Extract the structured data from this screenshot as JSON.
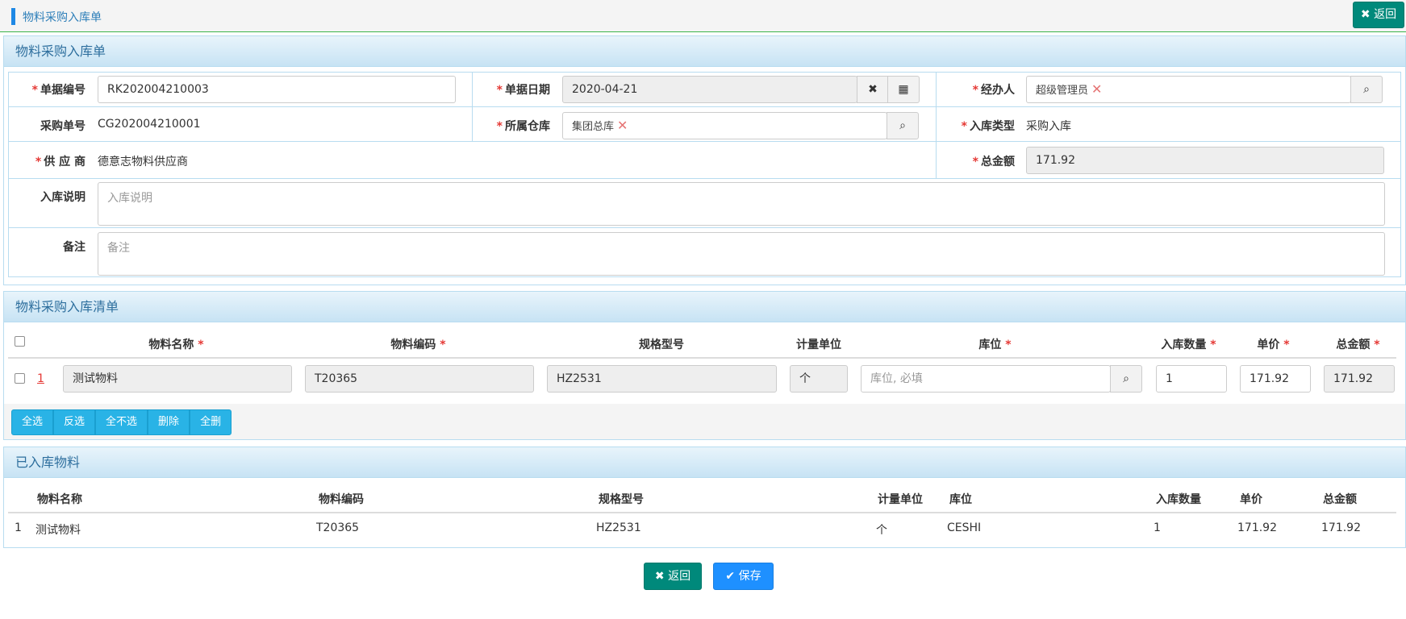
{
  "header": {
    "title": "物料采购入库单",
    "back_label": "✖ 返回"
  },
  "form_panel": {
    "title": "物料采购入库单",
    "fields": {
      "doc_no_label": "单据编号",
      "doc_no_value": "RK202004210003",
      "doc_date_label": "单据日期",
      "doc_date_value": "2020-04-21",
      "handler_label": "经办人",
      "handler_value": "超级管理员",
      "po_no_label": "采购单号",
      "po_no_value": "CG202004210001",
      "warehouse_label": "所属仓库",
      "warehouse_value": "集团总库",
      "in_type_label": "入库类型",
      "in_type_value": "采购入库",
      "supplier_label": "供 应 商",
      "supplier_value": "德意志物料供应商",
      "total_label": "总金额",
      "total_value": "171.92",
      "desc_label": "入库说明",
      "desc_placeholder": "入库说明",
      "remark_label": "备注",
      "remark_placeholder": "备注"
    }
  },
  "list_panel": {
    "title": "物料采购入库清单",
    "columns": [
      "物料名称",
      "物料编码",
      "规格型号",
      "计量单位",
      "库位",
      "入库数量",
      "单价",
      "总金额"
    ],
    "rows": [
      {
        "index": "1",
        "name": "测试物料",
        "code": "T20365",
        "spec": "HZ2531",
        "unit": "个",
        "location_placeholder": "库位, 必填",
        "qty": "1",
        "price": "171.92",
        "amount": "171.92"
      }
    ],
    "buttons": [
      "全选",
      "反选",
      "全不选",
      "删除",
      "全删"
    ]
  },
  "stored_panel": {
    "title": "已入库物料",
    "columns": [
      "物料名称",
      "物料编码",
      "规格型号",
      "计量单位",
      "库位",
      "入库数量",
      "单价",
      "总金额"
    ],
    "rows": [
      {
        "index": "1",
        "name": "测试物料",
        "code": "T20365",
        "spec": "HZ2531",
        "unit": "个",
        "location": "CESHI",
        "qty": "1",
        "price": "171.92",
        "amount": "171.92"
      }
    ]
  },
  "footer": {
    "back_label": "✖ 返回",
    "save_label": "✔ 保存"
  },
  "colors": {
    "teal_button": "#00897b",
    "blue_button": "#1e90ff",
    "panel_header": "#c7e3f4",
    "required": "#e53935"
  }
}
